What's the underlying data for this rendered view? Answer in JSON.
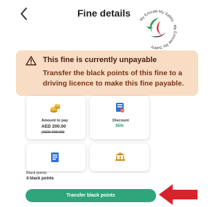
{
  "header": {
    "title": "Fine details",
    "logo_text": "My Emirate My Safety"
  },
  "banner": {
    "title": "This fine is currently unpayable",
    "message": "Transfer the black points of this fine to a driving licence to make this fine payable."
  },
  "cards": {
    "amount": {
      "label": "Amount to pay",
      "value": "AED 200.00",
      "original": "(AED 400.00)",
      "icon": "coins-icon"
    },
    "discount": {
      "label": "Discount",
      "value": "35%",
      "icon": "discount-icon"
    },
    "row2_left_icon": "document-icon",
    "row2_right_icon": "government-building-icon"
  },
  "points": {
    "label": "Black points",
    "value": "4 black points"
  },
  "action": {
    "transfer_label": "Transfer black points"
  },
  "colors": {
    "banner_bg": "#f8ddc4",
    "button": "#2fa57c",
    "discount": "#1f9a63",
    "arrow": "#d9232a"
  }
}
